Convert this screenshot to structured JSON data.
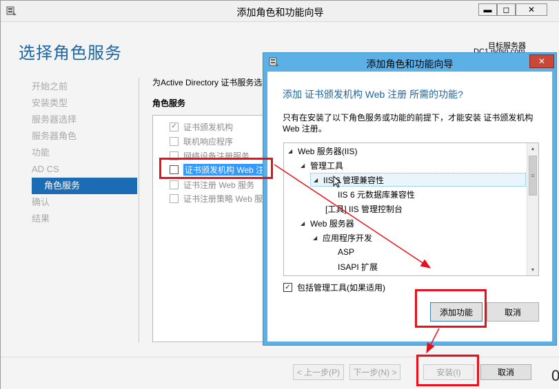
{
  "main_window": {
    "title": "添加角色和功能向导",
    "controls": {
      "minimize": "▬",
      "maximize": "◻",
      "close": "✕"
    }
  },
  "page": {
    "title": "选择角色服务",
    "target_label": "目标服务器",
    "target_server": "DC1.jsdsn.com"
  },
  "nav": {
    "items": [
      {
        "label": "开始之前",
        "active": false
      },
      {
        "label": "安装类型",
        "active": false
      },
      {
        "label": "服务器选择",
        "active": false
      },
      {
        "label": "服务器角色",
        "active": false
      },
      {
        "label": "功能",
        "active": false
      },
      {
        "label": "AD CS",
        "active": false
      },
      {
        "label": "角色服务",
        "active": true
      },
      {
        "label": "确认",
        "active": false
      },
      {
        "label": "结果",
        "active": false
      }
    ]
  },
  "content": {
    "description": "为Active Directory 证书服务选",
    "roles_heading": "角色服务",
    "roles": [
      {
        "label": "证书颁发机构",
        "checked": true,
        "selected": false
      },
      {
        "label": "联机响应程序",
        "checked": false,
        "selected": false
      },
      {
        "label": "网络设备注册服务",
        "checked": false,
        "selected": false
      },
      {
        "label": "证书颁发机构 Web 注",
        "checked": false,
        "selected": true
      },
      {
        "label": "证书注册 Web 服务",
        "checked": false,
        "selected": false
      },
      {
        "label": "证书注册策略 Web 服",
        "checked": false,
        "selected": false
      }
    ]
  },
  "footer": {
    "prev": "< 上一步(P)",
    "next": "下一步(N) >",
    "install": "安装(I)",
    "cancel": "取消",
    "edge_text": "0"
  },
  "dialog": {
    "title": "添加角色和功能向导",
    "close": "✕",
    "heading": "添加 证书颁发机构 Web 注册 所需的功能?",
    "description": "只有在安装了以下角色服务或功能的前提下，才能安装 证书颁发机构 Web 注册。",
    "tree": [
      {
        "label": "Web 服务器(IIS)",
        "expand": "◢",
        "highlight": false
      },
      {
        "label": "管理工具",
        "expand": "◢",
        "highlight": false
      },
      {
        "label": "IIS 6 管理兼容性",
        "expand": "◢",
        "highlight": true
      },
      {
        "label": "IIS 6 元数据库兼容性",
        "expand": "",
        "highlight": false
      },
      {
        "label": "[工具] IIS 管理控制台",
        "expand": "",
        "highlight": false
      },
      {
        "label": "Web 服务器",
        "expand": "◢",
        "highlight": false
      },
      {
        "label": "应用程序开发",
        "expand": "◢",
        "highlight": false
      },
      {
        "label": "ASP",
        "expand": "",
        "highlight": false
      },
      {
        "label": "ISAPI 扩展",
        "expand": "",
        "highlight": false
      }
    ],
    "include_tools": {
      "label": "包括管理工具(如果适用)",
      "checked": true
    },
    "add_button": "添加功能",
    "cancel_button": "取消"
  },
  "annotation_color": "#e8111b",
  "icons": {
    "app": "server-manager-icon",
    "check": "✓"
  }
}
